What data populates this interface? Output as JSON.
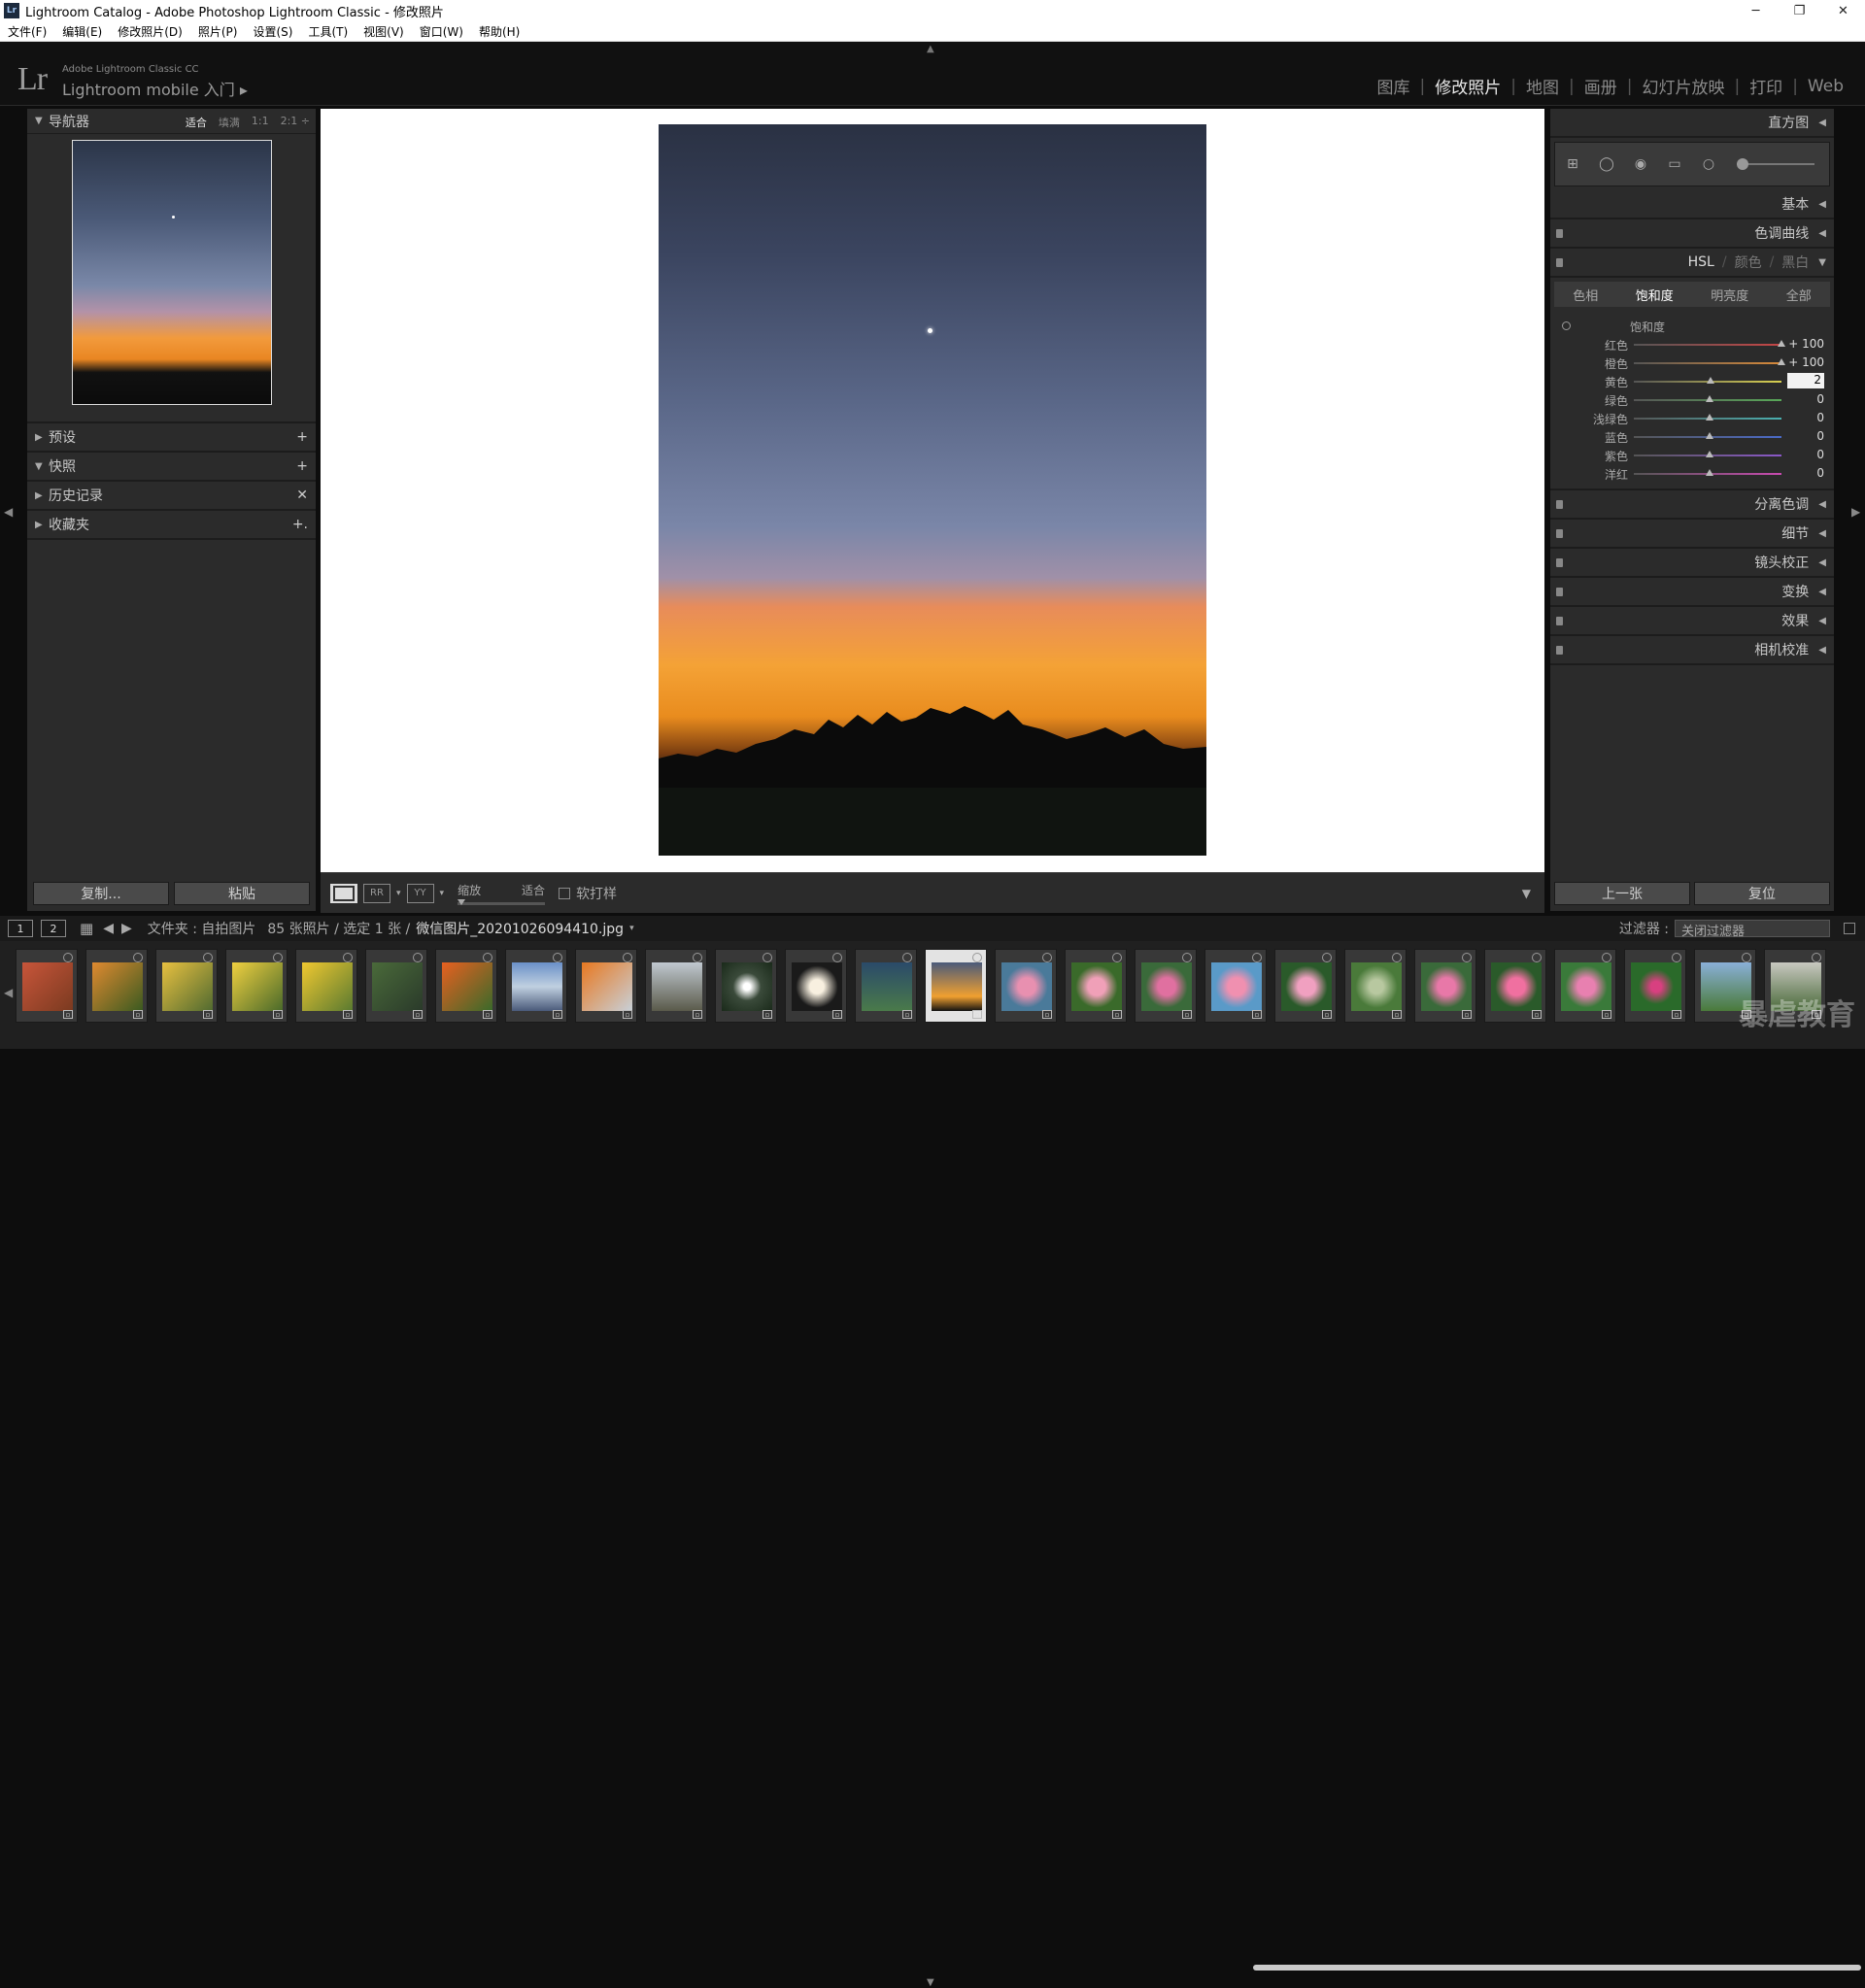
{
  "window": {
    "title": "Lightroom Catalog - Adobe Photoshop Lightroom Classic - 修改照片",
    "app_icon": "Lr",
    "min": "─",
    "max": "❐",
    "close": "✕"
  },
  "menu": [
    "文件(F)",
    "编辑(E)",
    "修改照片(D)",
    "照片(P)",
    "设置(S)",
    "工具(T)",
    "视图(V)",
    "窗口(W)",
    "帮助(H)"
  ],
  "identity": {
    "logo": "Lr",
    "line1": "Adobe Lightroom Classic CC",
    "line2": "Lightroom mobile 入门 ▸"
  },
  "modules": [
    {
      "label": "图库",
      "active": false
    },
    {
      "label": "修改照片",
      "active": true
    },
    {
      "label": "地图",
      "active": false
    },
    {
      "label": "画册",
      "active": false
    },
    {
      "label": "幻灯片放映",
      "active": false
    },
    {
      "label": "打印",
      "active": false
    },
    {
      "label": "Web",
      "active": false
    }
  ],
  "left": {
    "navigator": {
      "title": "导航器",
      "options": [
        "适合",
        "填满",
        "1:1",
        "2:1 ÷"
      ],
      "selected": "适合"
    },
    "sections": [
      {
        "title": "预设",
        "action": "+"
      },
      {
        "title": "快照",
        "action": "+",
        "open": true
      },
      {
        "title": "历史记录",
        "action": "✕"
      },
      {
        "title": "收藏夹",
        "action": "+."
      }
    ],
    "copy_btn": "复制...",
    "paste_btn": "粘贴"
  },
  "toolbar": {
    "zoom_label": "缩放",
    "zoom_value": "适合",
    "softproof_label": "软打样"
  },
  "right": {
    "histogram": "直方图",
    "basic": "基本",
    "tone_curve": "色调曲线",
    "hsl_tabs": [
      "HSL",
      "颜色",
      "黑白"
    ],
    "hsl_subtabs": [
      "色相",
      "饱和度",
      "明亮度",
      "全部"
    ],
    "hsl_selected": "饱和度",
    "hsl_group_label": "饱和度",
    "hsl_rows": [
      {
        "label": "红色",
        "value": "+ 100",
        "pos": 1.0,
        "color": "#c64545"
      },
      {
        "label": "橙色",
        "value": "+ 100",
        "pos": 1.0,
        "color": "#d88a3a"
      },
      {
        "label": "黄色",
        "value": "2",
        "pos": 0.51,
        "color": "#d8d050",
        "editing": true
      },
      {
        "label": "绿色",
        "value": "0",
        "pos": 0.5,
        "color": "#58a858"
      },
      {
        "label": "浅绿色",
        "value": "0",
        "pos": 0.5,
        "color": "#4ab0b0"
      },
      {
        "label": "蓝色",
        "value": "0",
        "pos": 0.5,
        "color": "#4a6ac8"
      },
      {
        "label": "紫色",
        "value": "0",
        "pos": 0.5,
        "color": "#8a58c8"
      },
      {
        "label": "洋红",
        "value": "0",
        "pos": 0.5,
        "color": "#c84ab0"
      }
    ],
    "more_panels": [
      "分离色调",
      "细节",
      "镜头校正",
      "变换",
      "效果",
      "相机校准"
    ],
    "prev_btn": "上一张",
    "reset_btn": "复位"
  },
  "filmstrip": {
    "view1": "1",
    "view2": "2",
    "path": "文件夹 : 自拍图片",
    "count": "85 张照片 / 选定 1 张 /",
    "filename": "微信图片_20201026094410.jpg",
    "filter_label": "过滤器 :",
    "filter_value": "关闭过滤器",
    "thumbs": [
      {
        "bg": "linear-gradient(135deg,#c8553a,#7a3a20)"
      },
      {
        "bg": "linear-gradient(135deg,#e08a30,#3a5a20)"
      },
      {
        "bg": "linear-gradient(135deg,#e8c040,#506a30)"
      },
      {
        "bg": "linear-gradient(135deg,#f0d040,#4a6a2a)"
      },
      {
        "bg": "linear-gradient(135deg,#f0c830,#5a7a30)"
      },
      {
        "bg": "linear-gradient(135deg,#4a6a3a,#2a3a2a)"
      },
      {
        "bg": "linear-gradient(135deg,#e86020,#3a6a2a)"
      },
      {
        "bg": "linear-gradient(180deg,#6a90c8,#c0d0e0,#4a5a7a)"
      },
      {
        "bg": "linear-gradient(135deg,#e87820,#c8d0d8)"
      },
      {
        "bg": "linear-gradient(180deg,#c0c8d0,#5a5a4a)"
      },
      {
        "bg": "radial-gradient(circle,#ffffff 10%,#3a4a3a 40%,#1a2a1a)"
      },
      {
        "bg": "radial-gradient(circle,#f8f0e0 20%,#1a1a1a 60%)"
      },
      {
        "bg": "linear-gradient(180deg,#2a4a6a,#4a7a4a)"
      },
      {
        "bg": "linear-gradient(180deg,#4a5a7a,#f0a030 70%,#111)",
        "selected": true
      },
      {
        "bg": "radial-gradient(circle,#e890b0 25%,#4a7a9a 60%)"
      },
      {
        "bg": "radial-gradient(circle,#f0a0b8 25%,#3a6a2a 60%)"
      },
      {
        "bg": "radial-gradient(circle,#e070a0 25%,#3a6a3a 60%)"
      },
      {
        "bg": "radial-gradient(circle,#f090b0 25%,#5a9ac8 60%)"
      },
      {
        "bg": "radial-gradient(circle,#f0a0c0 25%,#2a5a2a 60%)"
      },
      {
        "bg": "radial-gradient(circle,#b8c8a0 20%,#4a7a3a 60%)"
      },
      {
        "bg": "radial-gradient(circle,#e878a8 25%,#3a6a3a 60%)"
      },
      {
        "bg": "radial-gradient(circle,#f070a0 25%,#2a5a2a 60%)"
      },
      {
        "bg": "radial-gradient(circle,#e880b0 25%,#3a7a3a 60%)"
      },
      {
        "bg": "radial-gradient(circle,#d84080 15%,#2a6a2a 50%)"
      },
      {
        "bg": "linear-gradient(180deg,#8ab0d8,#4a7a3a)"
      },
      {
        "bg": "linear-gradient(180deg,#c8c8c0,#4a6a3a)"
      }
    ]
  },
  "watermark": "暴虐教育"
}
